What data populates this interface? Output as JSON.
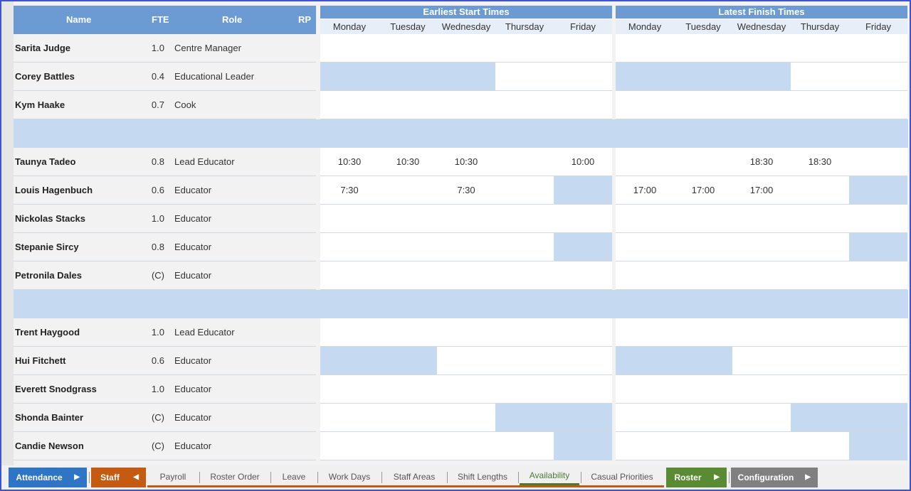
{
  "columns": {
    "name": "Name",
    "fte": "FTE",
    "role": "Role",
    "rp": "RP"
  },
  "start_title": "Earliest Start Times",
  "finish_title": "Latest Finish Times",
  "days": [
    "Monday",
    "Tuesday",
    "Wednesday",
    "Thursday",
    "Friday"
  ],
  "rows": [
    {
      "name": "Sarita Judge",
      "fte": "1.0",
      "role": "Centre Manager",
      "start": [
        "",
        "",
        "",
        "",
        ""
      ],
      "finish": [
        "",
        "",
        "",
        "",
        ""
      ],
      "start_unavailable": [
        false,
        false,
        false,
        false,
        false
      ],
      "finish_unavailable": [
        false,
        false,
        false,
        false,
        false
      ]
    },
    {
      "name": "Corey Battles",
      "fte": "0.4",
      "role": "Educational Leader",
      "start": [
        "",
        "",
        "",
        "",
        ""
      ],
      "finish": [
        "",
        "",
        "",
        "",
        ""
      ],
      "start_unavailable": [
        true,
        true,
        true,
        false,
        false
      ],
      "finish_unavailable": [
        true,
        true,
        true,
        false,
        false
      ]
    },
    {
      "name": "Kym Haake",
      "fte": "0.7",
      "role": "Cook",
      "start": [
        "",
        "",
        "",
        "",
        ""
      ],
      "finish": [
        "",
        "",
        "",
        "",
        ""
      ],
      "start_unavailable": [
        false,
        false,
        false,
        false,
        false
      ],
      "finish_unavailable": [
        false,
        false,
        false,
        false,
        false
      ]
    },
    {
      "separator": true
    },
    {
      "name": "Taunya Tadeo",
      "fte": "0.8",
      "role": "Lead Educator",
      "start": [
        "10:30",
        "10:30",
        "10:30",
        "",
        "10:00"
      ],
      "finish": [
        "",
        "",
        "18:30",
        "18:30",
        ""
      ],
      "start_unavailable": [
        false,
        false,
        false,
        false,
        false
      ],
      "finish_unavailable": [
        false,
        false,
        false,
        false,
        false
      ]
    },
    {
      "name": "Louis Hagenbuch",
      "fte": "0.6",
      "role": "Educator",
      "start": [
        "7:30",
        "",
        "7:30",
        "",
        ""
      ],
      "finish": [
        "17:00",
        "17:00",
        "17:00",
        "",
        ""
      ],
      "start_unavailable": [
        false,
        false,
        false,
        false,
        true
      ],
      "finish_unavailable": [
        false,
        false,
        false,
        false,
        true
      ]
    },
    {
      "name": "Nickolas Stacks",
      "fte": "1.0",
      "role": "Educator",
      "start": [
        "",
        "",
        "",
        "",
        ""
      ],
      "finish": [
        "",
        "",
        "",
        "",
        ""
      ],
      "start_unavailable": [
        false,
        false,
        false,
        false,
        false
      ],
      "finish_unavailable": [
        false,
        false,
        false,
        false,
        false
      ]
    },
    {
      "name": "Stepanie Sircy",
      "fte": "0.8",
      "role": "Educator",
      "start": [
        "",
        "",
        "",
        "",
        ""
      ],
      "finish": [
        "",
        "",
        "",
        "",
        ""
      ],
      "start_unavailable": [
        false,
        false,
        false,
        false,
        true
      ],
      "finish_unavailable": [
        false,
        false,
        false,
        false,
        true
      ]
    },
    {
      "name": "Petronila Dales",
      "fte": "(C)",
      "role": "Educator",
      "start": [
        "",
        "",
        "",
        "",
        ""
      ],
      "finish": [
        "",
        "",
        "",
        "",
        ""
      ],
      "start_unavailable": [
        false,
        false,
        false,
        false,
        false
      ],
      "finish_unavailable": [
        false,
        false,
        false,
        false,
        false
      ]
    },
    {
      "separator": true
    },
    {
      "name": "Trent Haygood",
      "fte": "1.0",
      "role": "Lead Educator",
      "start": [
        "",
        "",
        "",
        "",
        ""
      ],
      "finish": [
        "",
        "",
        "",
        "",
        ""
      ],
      "start_unavailable": [
        false,
        false,
        false,
        false,
        false
      ],
      "finish_unavailable": [
        false,
        false,
        false,
        false,
        false
      ]
    },
    {
      "name": "Hui Fitchett",
      "fte": "0.6",
      "role": "Educator",
      "start": [
        "",
        "",
        "",
        "",
        ""
      ],
      "finish": [
        "",
        "",
        "",
        "",
        ""
      ],
      "start_unavailable": [
        true,
        true,
        false,
        false,
        false
      ],
      "finish_unavailable": [
        true,
        true,
        false,
        false,
        false
      ]
    },
    {
      "name": "Everett Snodgrass",
      "fte": "1.0",
      "role": "Educator",
      "start": [
        "",
        "",
        "",
        "",
        ""
      ],
      "finish": [
        "",
        "",
        "",
        "",
        ""
      ],
      "start_unavailable": [
        false,
        false,
        false,
        false,
        false
      ],
      "finish_unavailable": [
        false,
        false,
        false,
        false,
        false
      ]
    },
    {
      "name": "Shonda Bainter",
      "fte": "(C)",
      "role": "Educator",
      "start": [
        "",
        "",
        "",
        "",
        ""
      ],
      "finish": [
        "",
        "",
        "",
        "",
        ""
      ],
      "start_unavailable": [
        false,
        false,
        false,
        true,
        true
      ],
      "finish_unavailable": [
        false,
        false,
        false,
        true,
        true
      ]
    },
    {
      "name": "Candie Newson",
      "fte": "(C)",
      "role": "Educator",
      "start": [
        "",
        "",
        "",
        "",
        ""
      ],
      "finish": [
        "",
        "",
        "",
        "",
        ""
      ],
      "start_unavailable": [
        false,
        false,
        false,
        false,
        true
      ],
      "finish_unavailable": [
        false,
        false,
        false,
        false,
        true
      ]
    }
  ],
  "tabs": {
    "attendance": "Attendance",
    "staff": "Staff",
    "subtabs": [
      "Payroll",
      "Roster Order",
      "Leave",
      "Work Days",
      "Staff Areas",
      "Shift Lengths",
      "Availability",
      "Casual Priorities"
    ],
    "active_subtab": "Availability",
    "roster": "Roster",
    "configuration": "Configuration"
  },
  "colors": {
    "header_blue": "#6b9bd2",
    "unavailable_blue": "#c5d9f0",
    "attendance_tab": "#2e75c6",
    "staff_tab": "#c55a11",
    "roster_tab": "#5a8a32",
    "configuration_tab": "#808080",
    "frame_border": "#3d52d5"
  }
}
